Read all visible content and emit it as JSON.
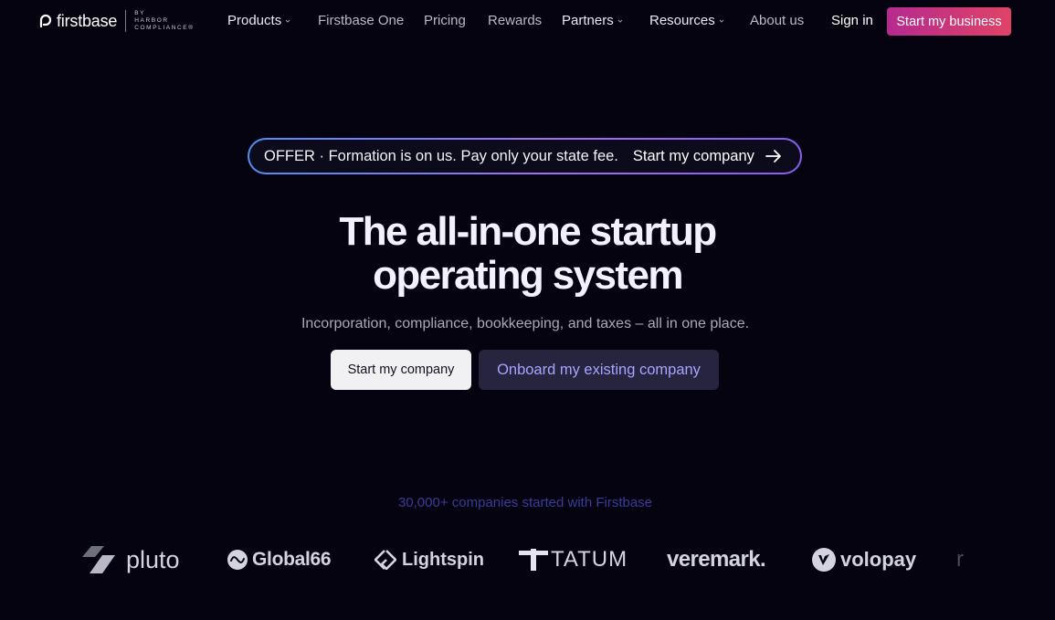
{
  "nav": {
    "logo": {
      "text": "firstbase",
      "by_line1": "BY",
      "by_line2": "HARBOR",
      "by_line3": "COMPLIANCE®"
    },
    "items": [
      {
        "label": "Products",
        "dropdown": true
      },
      {
        "label": "Firstbase One",
        "dropdown": false
      },
      {
        "label": "Pricing",
        "dropdown": false
      },
      {
        "label": "Rewards",
        "dropdown": false
      },
      {
        "label": "Partners",
        "dropdown": true
      },
      {
        "label": "Resources",
        "dropdown": true
      },
      {
        "label": "About us",
        "dropdown": false
      }
    ],
    "sign_in": "Sign in",
    "cta": "Start my business"
  },
  "offer": {
    "text": "OFFER · Formation is on us. Pay only your state fee.",
    "link": "Start my company",
    "icon": "arrow-right-icon"
  },
  "hero": {
    "title_line1": "The all-in-one startup",
    "title_line2": "operating system",
    "subtitle": "Incorporation, compliance, bookkeeping, and taxes – all in one place.",
    "primary_button": "Start my company",
    "secondary_button": "Onboard my existing company"
  },
  "social_proof": {
    "text": "30,000+ companies started with Firstbase",
    "logos": [
      {
        "name": "pluto",
        "icon": "pluto-logo-icon"
      },
      {
        "name": "Global66",
        "icon": "global66-logo-icon"
      },
      {
        "name": "Lightspin",
        "icon": "lightspin-logo-icon"
      },
      {
        "name": "TATUM",
        "icon": "tatum-logo-icon"
      },
      {
        "name": "veremark.",
        "icon": ""
      },
      {
        "name": "volopay",
        "icon": "volopay-logo-icon"
      },
      {
        "name": "r",
        "icon": ""
      }
    ]
  },
  "colors": {
    "background": "#04030f",
    "cta_gradient_start": "#b52a8e",
    "cta_gradient_end": "#e04367",
    "offer_border_start": "#4f8ff0",
    "offer_border_end": "#a36ef2",
    "secondary_button_bg": "#26243f",
    "secondary_button_text": "#a8a4ff",
    "proof_text": "#3c3a9a"
  }
}
